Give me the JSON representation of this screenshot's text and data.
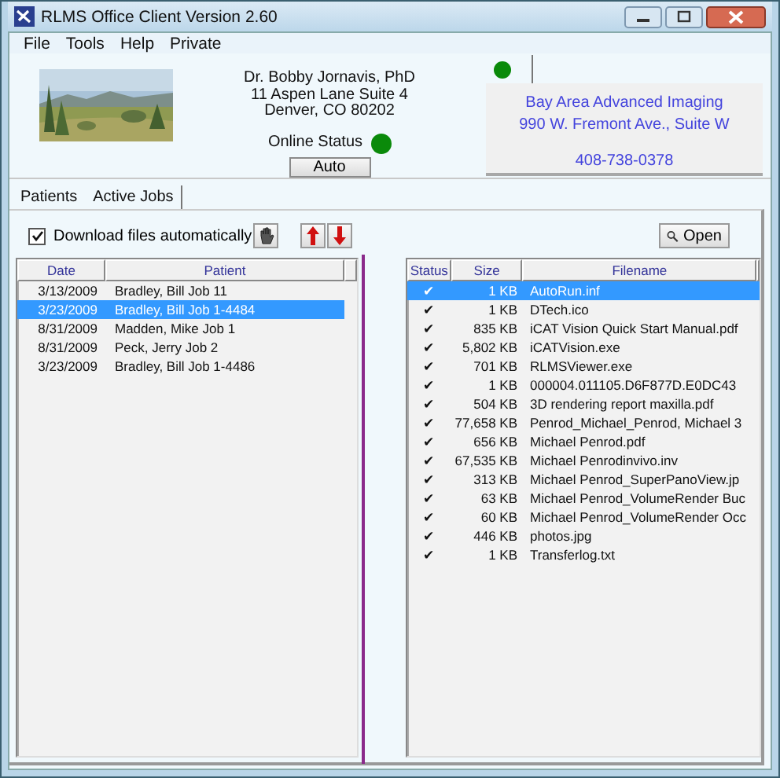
{
  "window": {
    "title": "RLMS Office Client Version 2.60"
  },
  "menu": [
    {
      "label": "File"
    },
    {
      "label": "Tools"
    },
    {
      "label": "Help"
    },
    {
      "label": "Private"
    }
  ],
  "doctor": {
    "name": "Dr. Bobby Jornavis, PhD",
    "address": "11 Aspen Lane Suite 4",
    "city": "Denver, CO  80202"
  },
  "online_status": {
    "label": "Online Status",
    "online": true
  },
  "mode_button": "Auto",
  "lab_panel": {
    "connected": true,
    "name": "Bay Area Advanced Imaging",
    "address": "990 W. Fremont Ave., Suite W",
    "phone": "408-738-0378"
  },
  "tabs": [
    {
      "label": "Patients",
      "selected": false
    },
    {
      "label": "Active Jobs",
      "selected": true
    }
  ],
  "download_auto": {
    "label": "Download files automatically",
    "checked": true
  },
  "open_button": "Open",
  "jobs": {
    "columns": [
      "Date",
      "Patient"
    ],
    "rows": [
      {
        "date": "3/13/2009",
        "patient": "Bradley, Bill  Job 11",
        "selected": false
      },
      {
        "date": "3/23/2009",
        "patient": "Bradley, Bill  Job 1-4484",
        "selected": true
      },
      {
        "date": "8/31/2009",
        "patient": "Madden, Mike  Job 1",
        "selected": false
      },
      {
        "date": "8/31/2009",
        "patient": "Peck, Jerry  Job 2",
        "selected": false
      },
      {
        "date": "3/23/2009",
        "patient": "Bradley, Bill  Job 1-4486",
        "selected": false
      }
    ]
  },
  "files": {
    "columns": [
      "Status",
      "Size",
      "Filename"
    ],
    "rows": [
      {
        "status": "✔",
        "size": "1 KB",
        "filename": "AutoRun.inf",
        "selected": true
      },
      {
        "status": "✔",
        "size": "1 KB",
        "filename": "DTech.ico",
        "selected": false
      },
      {
        "status": "✔",
        "size": "835 KB",
        "filename": "iCAT Vision Quick Start Manual.pdf",
        "selected": false
      },
      {
        "status": "✔",
        "size": "5,802 KB",
        "filename": "iCATVision.exe",
        "selected": false
      },
      {
        "status": "✔",
        "size": "701 KB",
        "filename": "RLMSViewer.exe",
        "selected": false
      },
      {
        "status": "✔",
        "size": "1 KB",
        "filename": "000004.011105.D6F877D.E0DC43",
        "selected": false
      },
      {
        "status": "✔",
        "size": "504 KB",
        "filename": "3D rendering report maxilla.pdf",
        "selected": false
      },
      {
        "status": "✔",
        "size": "77,658 KB",
        "filename": "Penrod_Michael_Penrod, Michael 3",
        "selected": false
      },
      {
        "status": "✔",
        "size": "656 KB",
        "filename": "Michael Penrod.pdf",
        "selected": false
      },
      {
        "status": "✔",
        "size": "67,535 KB",
        "filename": "Michael Penrodinvivo.inv",
        "selected": false
      },
      {
        "status": "✔",
        "size": "313 KB",
        "filename": "Michael Penrod_SuperPanoView.jp",
        "selected": false
      },
      {
        "status": "✔",
        "size": "63 KB",
        "filename": "Michael Penrod_VolumeRender Buc",
        "selected": false
      },
      {
        "status": "✔",
        "size": "60 KB",
        "filename": "Michael Penrod_VolumeRender Occ",
        "selected": false
      },
      {
        "status": "✔",
        "size": "446 KB",
        "filename": "photos.jpg",
        "selected": false
      },
      {
        "status": "✔",
        "size": "1 KB",
        "filename": "Transferlog.txt",
        "selected": false
      }
    ]
  }
}
